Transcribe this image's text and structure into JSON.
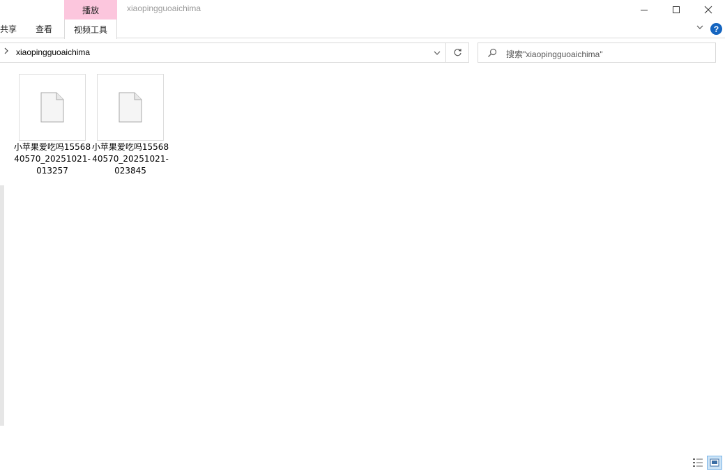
{
  "window": {
    "title": "xiaopingguoaichima",
    "context_tab_group": "播放",
    "context_tab_color": "#fcc6dd"
  },
  "ribbon": {
    "tabs": [
      {
        "label": "共享"
      },
      {
        "label": "查看"
      },
      {
        "label": "视频工具"
      }
    ],
    "help_label": "?"
  },
  "address": {
    "path": "xiaopingguoaichima"
  },
  "search": {
    "placeholder": "搜索\"xiaopingguoaichima\""
  },
  "files": [
    {
      "name": "小苹果爱吃吗1556840570_20251021-013257",
      "icon": "generic-file-icon"
    },
    {
      "name": "小苹果爱吃吗1556840570_20251021-023845",
      "icon": "generic-file-icon"
    }
  ],
  "statusbar": {
    "active_view": "large-icons"
  }
}
